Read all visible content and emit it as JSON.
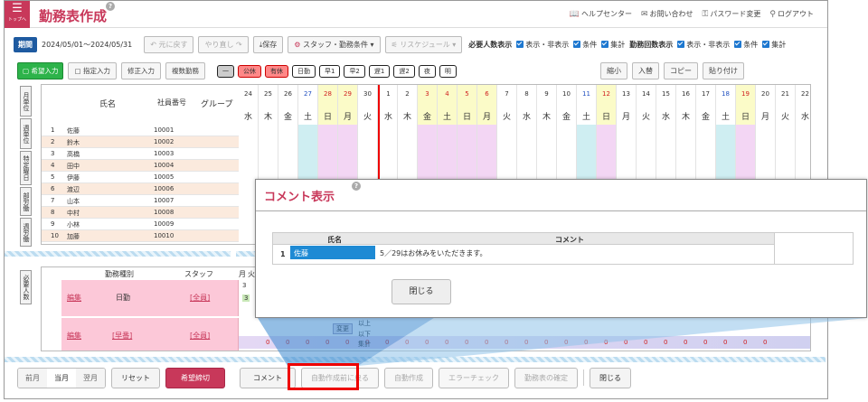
{
  "header": {
    "top_button_label": "トップへ",
    "title": "勤務表作成",
    "links": [
      "ヘルプセンター",
      "お問い合わせ",
      "パスワード変更",
      "ログアウト"
    ]
  },
  "toolbar": {
    "period_label": "期間",
    "period_value": "2024/05/01～2024/05/31",
    "undo": "元に戻す",
    "redo": "やり直し",
    "save": "保存",
    "staff_conditions": "スタッフ・勤務条件",
    "reschedule": "リスケジュール",
    "req_label": "必要人数表示",
    "show_hide": "表示・非表示",
    "condition": "条件",
    "total": "集計",
    "count_label": "勤務回数表示",
    "show_hide2": "表示・非表示",
    "condition2": "条件",
    "total2": "集計"
  },
  "toolbar2": {
    "wish_input": "希望入力",
    "fixed_input": "指定入力",
    "fix_input": "修正入力",
    "multi_duty": "複数勤務",
    "shifts": [
      "一",
      "公休",
      "有休",
      "日勤",
      "早1",
      "早2",
      "遅1",
      "遅2",
      "夜",
      "明"
    ],
    "shrink": "縮小",
    "swap": "入替",
    "copy": "コピー",
    "paste": "貼り付け"
  },
  "side_tabs": [
    "月単位",
    "週単位",
    "特定曜日",
    "部労働",
    "週労働",
    "必要人数"
  ],
  "grid": {
    "headers": {
      "name": "氏名",
      "staff_no": "社員番号",
      "group": "グループ"
    },
    "rows": [
      {
        "n": "1",
        "name": "佐藤",
        "id": "10001"
      },
      {
        "n": "2",
        "name": "鈴木",
        "id": "10002"
      },
      {
        "n": "3",
        "name": "高橋",
        "id": "10003"
      },
      {
        "n": "4",
        "name": "田中",
        "id": "10004"
      },
      {
        "n": "5",
        "name": "伊藤",
        "id": "10005"
      },
      {
        "n": "6",
        "name": "渡辺",
        "id": "10006"
      },
      {
        "n": "7",
        "name": "山本",
        "id": "10007"
      },
      {
        "n": "8",
        "name": "中村",
        "id": "10008"
      },
      {
        "n": "9",
        "name": "小林",
        "id": "10009"
      },
      {
        "n": "10",
        "name": "加藤",
        "id": "10010"
      }
    ],
    "days": [
      {
        "d": "24",
        "w": "水",
        "t": "n"
      },
      {
        "d": "25",
        "w": "木",
        "t": "n"
      },
      {
        "d": "26",
        "w": "金",
        "t": "n"
      },
      {
        "d": "27",
        "w": "土",
        "t": "sat"
      },
      {
        "d": "28",
        "w": "日",
        "t": "sun"
      },
      {
        "d": "29",
        "w": "月",
        "t": "sun"
      },
      {
        "d": "30",
        "w": "火",
        "t": "n"
      },
      {
        "d": "1",
        "w": "水",
        "t": "n"
      },
      {
        "d": "2",
        "w": "木",
        "t": "n"
      },
      {
        "d": "3",
        "w": "金",
        "t": "sun"
      },
      {
        "d": "4",
        "w": "土",
        "t": "sun"
      },
      {
        "d": "5",
        "w": "日",
        "t": "sun"
      },
      {
        "d": "6",
        "w": "月",
        "t": "sun"
      },
      {
        "d": "7",
        "w": "火",
        "t": "n"
      },
      {
        "d": "8",
        "w": "水",
        "t": "n"
      },
      {
        "d": "9",
        "w": "木",
        "t": "n"
      },
      {
        "d": "10",
        "w": "金",
        "t": "n"
      },
      {
        "d": "11",
        "w": "土",
        "t": "sat"
      },
      {
        "d": "12",
        "w": "日",
        "t": "sun"
      },
      {
        "d": "13",
        "w": "月",
        "t": "n"
      },
      {
        "d": "14",
        "w": "火",
        "t": "n"
      },
      {
        "d": "15",
        "w": "水",
        "t": "n"
      },
      {
        "d": "16",
        "w": "木",
        "t": "n"
      },
      {
        "d": "17",
        "w": "金",
        "t": "n"
      },
      {
        "d": "18",
        "w": "土",
        "t": "sat"
      },
      {
        "d": "19",
        "w": "日",
        "t": "sun"
      },
      {
        "d": "20",
        "w": "月",
        "t": "n"
      },
      {
        "d": "21",
        "w": "火",
        "t": "n"
      },
      {
        "d": "22",
        "w": "水",
        "t": "n"
      }
    ]
  },
  "required": {
    "headers": {
      "type": "勤務種別",
      "staff": "スタッフ",
      "month": "月",
      "fire": "火"
    },
    "rows": [
      {
        "edit": "編集",
        "type": "日勤",
        "staff": "[全員]",
        "a": "3",
        "b": "3"
      },
      {
        "edit": "編集",
        "type": "[早番]",
        "staff": "[全員]",
        "a": "",
        "b": ""
      }
    ],
    "labels": {
      "henko": "変更",
      "ijo": "以上",
      "ika": "以下",
      "total": "集計"
    },
    "zero": "0"
  },
  "modal": {
    "title": "コメント表示",
    "col_name": "氏名",
    "col_comment": "コメント",
    "rows": [
      {
        "n": "1",
        "name": "佐藤",
        "comment": "5／29はお休みをいただきます。"
      }
    ],
    "close": "閉じる"
  },
  "bottom": {
    "prev": "前月",
    "cur": "当月",
    "next": "翌月",
    "reset": "リセット",
    "wish_close": "希望締切",
    "comment": "コメント",
    "revert": "自動作成前に戻る",
    "auto": "自動作成",
    "error_check": "エラーチェック",
    "confirm": "勤務表の確定",
    "close": "閉じる"
  },
  "colors": {
    "brand": "#c8385a",
    "highlight": "#e00000"
  }
}
